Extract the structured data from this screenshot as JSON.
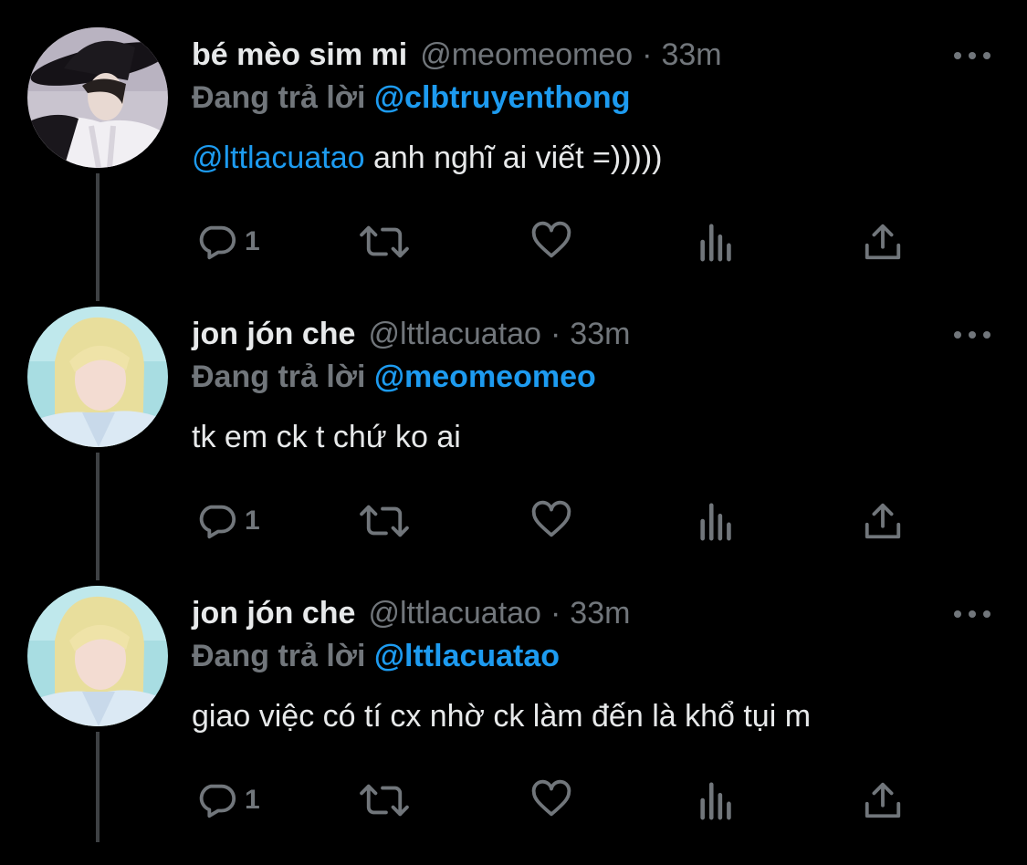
{
  "colors": {
    "background": "#000000",
    "text": "#e7e9ea",
    "muted": "#71767b",
    "link": "#1d9bf0",
    "thread_line": "#3e4144"
  },
  "tweets": [
    {
      "display_name": "bé mèo sim mi",
      "handle": "@meomeomeo",
      "separator": "·",
      "time": "33m",
      "reply_prefix": "Đang trả lời",
      "reply_to": "@clbtruyenthong",
      "mention": "@lttlacuatao",
      "text": " anh nghĩ ai viết =)))))",
      "reply_count": "1",
      "avatar_icon": "avatar-photo-black-hat"
    },
    {
      "display_name": "jon jón che",
      "handle": "@lttlacuatao",
      "separator": "·",
      "time": "33m",
      "reply_prefix": "Đang trả lời",
      "reply_to": "@meomeomeo",
      "mention": "",
      "text": "tk em ck t chứ ko ai",
      "reply_count": "1",
      "avatar_icon": "avatar-photo-blonde"
    },
    {
      "display_name": "jon jón che",
      "handle": "@lttlacuatao",
      "separator": "·",
      "time": "33m",
      "reply_prefix": "Đang trả lời",
      "reply_to": "@lttlacuatao",
      "mention": "",
      "text": "giao việc có tí cx nhờ ck làm đến là khổ tụi m",
      "reply_count": "1",
      "avatar_icon": "avatar-photo-blonde"
    }
  ],
  "action_icons": [
    "reply-icon",
    "retweet-icon",
    "like-icon",
    "views-icon",
    "share-icon"
  ]
}
